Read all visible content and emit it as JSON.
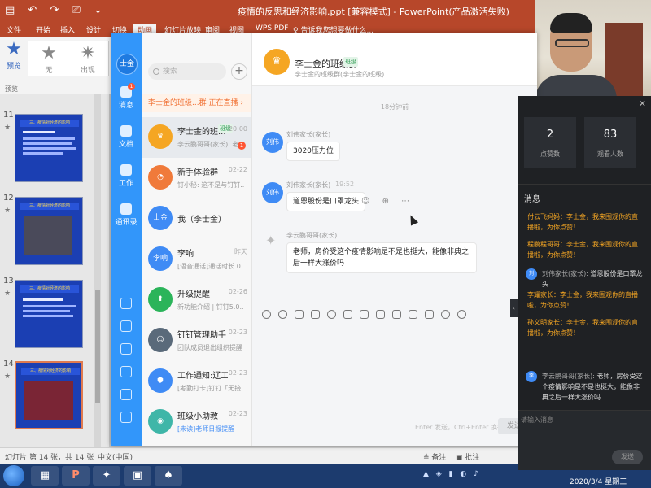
{
  "ppt": {
    "quick_access": "▤ ↶ ↷ ⎚ ⌄",
    "doc_title": "疫情的反思和经济影响.ppt [兼容模式] - PowerPoint(产品激活失败)",
    "tabs": [
      "文件",
      "开始",
      "插入",
      "设计",
      "切换",
      "动画",
      "幻灯片放映",
      "审阅",
      "视图",
      "WPS PDF",
      "♀ 告诉我您想要做什么..."
    ],
    "ribbon": {
      "preview": "预览",
      "none": "无",
      "appear": "出现",
      "group": "预览"
    },
    "slides": [
      {
        "num": "11",
        "star": "★",
        "head": "三、疫情对经济的影响"
      },
      {
        "num": "12",
        "star": "★",
        "head": "三、疫情对经济的影响"
      },
      {
        "num": "13",
        "star": "★",
        "head": "三、疫情对经济的影响"
      },
      {
        "num": "14",
        "star": "★",
        "head": "三、疫情对经济的影响"
      }
    ],
    "status": {
      "slide": "幻灯片 第 14 张，共 14 张",
      "lang": "中文(中国)",
      "notes": "≜ 备注",
      "comments": "▣ 批注"
    }
  },
  "taskbar": {
    "apps": [
      "▦",
      "P",
      "✦",
      "▣",
      "♠"
    ],
    "tray": "▲ ◈ ▮ ◐ ♪",
    "time": "2020/3/4 星期三"
  },
  "dingtalk": {
    "win_controls": {
      "min": "—",
      "max": "□",
      "close": "✕"
    },
    "user_short": "士金",
    "rail": [
      {
        "label": "消息",
        "badge": "1"
      },
      {
        "label": "文档"
      },
      {
        "label": "工作"
      },
      {
        "label": "通讯录"
      }
    ],
    "search_placeholder": "搜索",
    "plus": "+",
    "live_banner": "李士金的班级...群 正在直播 ›",
    "conversations": [
      {
        "avatar": "♛",
        "name": "李士金的班...",
        "tag": "班级",
        "time": "20:00",
        "preview": "李云鹏哥哥(家长): 老...",
        "badge": "1",
        "color": "#f5a623"
      },
      {
        "avatar": "◔",
        "name": "新手体验群",
        "time": "02-22",
        "preview": "钉小秘: 这不是与钉钉...",
        "color": "#f07a3a"
      },
      {
        "avatar": "士金",
        "name": "我（李士金）",
        "time": "",
        "preview": "",
        "color": "#3f8bf5"
      },
      {
        "avatar": "李响",
        "name": "李响",
        "time": "昨天",
        "preview": "[语音通话]通话时长 0...",
        "color": "#3f8bf5"
      },
      {
        "avatar": "⬆",
        "name": "升级提醒",
        "time": "02-26",
        "preview": "新功能介绍 | 钉钉5.0...",
        "color": "#2bb45a"
      },
      {
        "avatar": "☺",
        "name": "钉钉管理助手",
        "time": "02-23",
        "preview": "团队成员退出组织提醒",
        "color": "#5a6a7a"
      },
      {
        "avatar": "⬢",
        "name": "工作通知:辽工大",
        "time": "02-23",
        "preview": "[考勤打卡]钉钉「无接...",
        "color": "#3f8bf5"
      },
      {
        "avatar": "◉",
        "name": "班级小助教",
        "time": "02-23",
        "preview": "[未读]老师日报提醒",
        "color": "#3fb6a8"
      }
    ],
    "chat": {
      "logo": "♛",
      "title": "李士金的班级群",
      "tag": "班级",
      "subtitle": "李士金的班级群(李士金的班级)",
      "time_divider": "18分钟前",
      "messages": [
        {
          "avatar": "刘伟",
          "name": "刘伟家长(家长)",
          "time": "",
          "text": "3020压力位"
        },
        {
          "avatar": "刘伟",
          "name": "刘伟家长(家长)",
          "time": "19:52",
          "text": "道恩股份是口罩龙头"
        },
        {
          "avatar": "",
          "name": "李云鹏哥哥(家长)",
          "time": "",
          "text": "老师，房价受这个疫情影响是不是也挺大，能像非典之后一样大涨价吗"
        }
      ],
      "msg_tools": "☺ ⊕ ⋯",
      "input_hint": "Enter 发送，Ctrl+Enter 换行",
      "send": "发送"
    }
  },
  "live": {
    "close": "✕",
    "likes": "2",
    "likes_label": "点赞数",
    "viewers": "83",
    "viewers_label": "观看人数",
    "section": "消息",
    "gifts": [
      "付云飞妈妈：李士金，我来围观你的直播啦，为你点赞！",
      "程鹏程哥哥：李士金，我来围观你的直播啦，为你点赞！"
    ],
    "mid_msg": {
      "avatar": "刘",
      "name": "刘伟家长(家长):",
      "text": "道恩股份是口罩龙头"
    },
    "gifts2": [
      "李耀家长：李士金，我来围观你的直播啦，为你点赞！",
      "孙义明家长：李士金，我来围观你的直播啦，为你点赞！"
    ],
    "last_msg": {
      "avatar": "李",
      "name": "李云鹏哥哥(家长):",
      "text": "老师，房价受这个疫情影响是不是也挺大，能像非典之后一样大涨价吗"
    },
    "input_hint": "请输入消息",
    "send": "发送",
    "collapse": "‹"
  }
}
